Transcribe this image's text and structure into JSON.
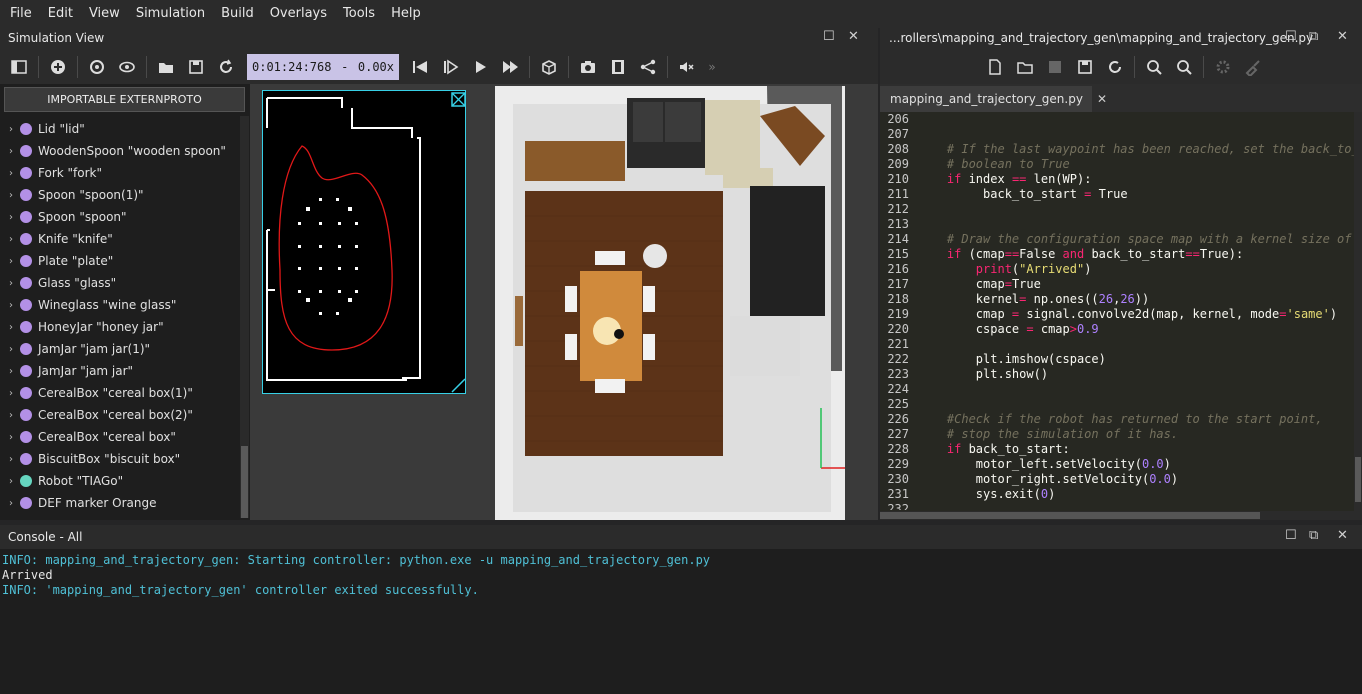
{
  "menubar": {
    "items": [
      "File",
      "Edit",
      "View",
      "Simulation",
      "Build",
      "Overlays",
      "Tools",
      "Help"
    ]
  },
  "simulation_view": {
    "title": "Simulation View",
    "time": "0:01:24:768",
    "time_sep": "-",
    "speed": "0.00x"
  },
  "editor": {
    "title": "...rollers\\mapping_and_trajectory_gen\\mapping_and_trajectory_gen.py",
    "tab_label": "mapping_and_trajectory_gen.py",
    "tab_close": "✕"
  },
  "scene_tree": {
    "extern_button": "IMPORTABLE EXTERNPROTO",
    "items": [
      {
        "label": "Lid \"lid\"",
        "icon": "proto-node-icon"
      },
      {
        "label": "WoodenSpoon \"wooden spoon\"",
        "icon": "proto-node-icon"
      },
      {
        "label": "Fork \"fork\"",
        "icon": "proto-node-icon"
      },
      {
        "label": "Spoon \"spoon(1)\"",
        "icon": "proto-node-icon"
      },
      {
        "label": "Spoon \"spoon\"",
        "icon": "proto-node-icon"
      },
      {
        "label": "Knife \"knife\"",
        "icon": "proto-node-icon"
      },
      {
        "label": "Plate \"plate\"",
        "icon": "proto-node-icon"
      },
      {
        "label": "Glass \"glass\"",
        "icon": "proto-node-icon"
      },
      {
        "label": "Wineglass \"wine glass\"",
        "icon": "proto-node-icon"
      },
      {
        "label": "HoneyJar \"honey jar\"",
        "icon": "proto-node-icon"
      },
      {
        "label": "JamJar \"jam jar(1)\"",
        "icon": "proto-node-icon"
      },
      {
        "label": "JamJar \"jam jar\"",
        "icon": "proto-node-icon"
      },
      {
        "label": "CerealBox \"cereal box(1)\"",
        "icon": "proto-node-icon"
      },
      {
        "label": "CerealBox \"cereal box(2)\"",
        "icon": "proto-node-icon"
      },
      {
        "label": "CerealBox \"cereal box\"",
        "icon": "proto-node-icon"
      },
      {
        "label": "BiscuitBox \"biscuit box\"",
        "icon": "proto-node-icon"
      },
      {
        "label": "Robot \"TIAGo\"",
        "icon": "robot-node-icon"
      },
      {
        "label": "DEF marker Orange",
        "icon": "proto-node-icon"
      }
    ]
  },
  "code": {
    "lines": [
      {
        "n": "206",
        "t": ""
      },
      {
        "n": "207",
        "t": ""
      },
      {
        "n": "208",
        "t": "    # If the last waypoint has been reached, set the back_to_st"
      },
      {
        "n": "209",
        "t": "    # boolean to True"
      },
      {
        "n": "210",
        "t": "    if index == len(WP):"
      },
      {
        "n": "211",
        "t": "         back_to_start = True"
      },
      {
        "n": "212",
        "t": ""
      },
      {
        "n": "213",
        "t": ""
      },
      {
        "n": "214",
        "t": "    # Draw the configuration space map with a kernel size of 27"
      },
      {
        "n": "215",
        "t": "    if (cmap==False and back_to_start==True):"
      },
      {
        "n": "216",
        "t": "        print(\"Arrived\")"
      },
      {
        "n": "217",
        "t": "        cmap=True"
      },
      {
        "n": "218",
        "t": "        kernel= np.ones((26,26))"
      },
      {
        "n": "219",
        "t": "        cmap = signal.convolve2d(map, kernel, mode='same')"
      },
      {
        "n": "220",
        "t": "        cspace = cmap>0.9"
      },
      {
        "n": "221",
        "t": ""
      },
      {
        "n": "222",
        "t": "        plt.imshow(cspace)"
      },
      {
        "n": "223",
        "t": "        plt.show()"
      },
      {
        "n": "224",
        "t": ""
      },
      {
        "n": "225",
        "t": ""
      },
      {
        "n": "226",
        "t": "    #Check if the robot has returned to the start point,"
      },
      {
        "n": "227",
        "t": "    # stop the simulation of it has."
      },
      {
        "n": "228",
        "t": "    if back_to_start:"
      },
      {
        "n": "229",
        "t": "        motor_left.setVelocity(0.0)"
      },
      {
        "n": "230",
        "t": "        motor_right.setVelocity(0.0)"
      },
      {
        "n": "231",
        "t": "        sys.exit(0)"
      },
      {
        "n": "232",
        "t": ""
      }
    ]
  },
  "console": {
    "title": "Console - All",
    "lines": [
      {
        "kind": "info",
        "text": "INFO: mapping_and_trajectory_gen: Starting controller: python.exe -u mapping_and_trajectory_gen.py"
      },
      {
        "kind": "plain",
        "text": "Arrived"
      },
      {
        "kind": "info",
        "text": "INFO: 'mapping_and_trajectory_gen' controller exited successfully."
      }
    ]
  },
  "window_buttons": {
    "restore": "☐",
    "close": "✕",
    "float": "⧉"
  },
  "colors": {
    "accent_time": "#c9c3e6",
    "info_text": "#4fc0d6",
    "proto_dot": "#b390e6",
    "robot_dot": "#66d6c0",
    "path_red": "#e01818",
    "overlay_cyan": "#37d0e6"
  }
}
